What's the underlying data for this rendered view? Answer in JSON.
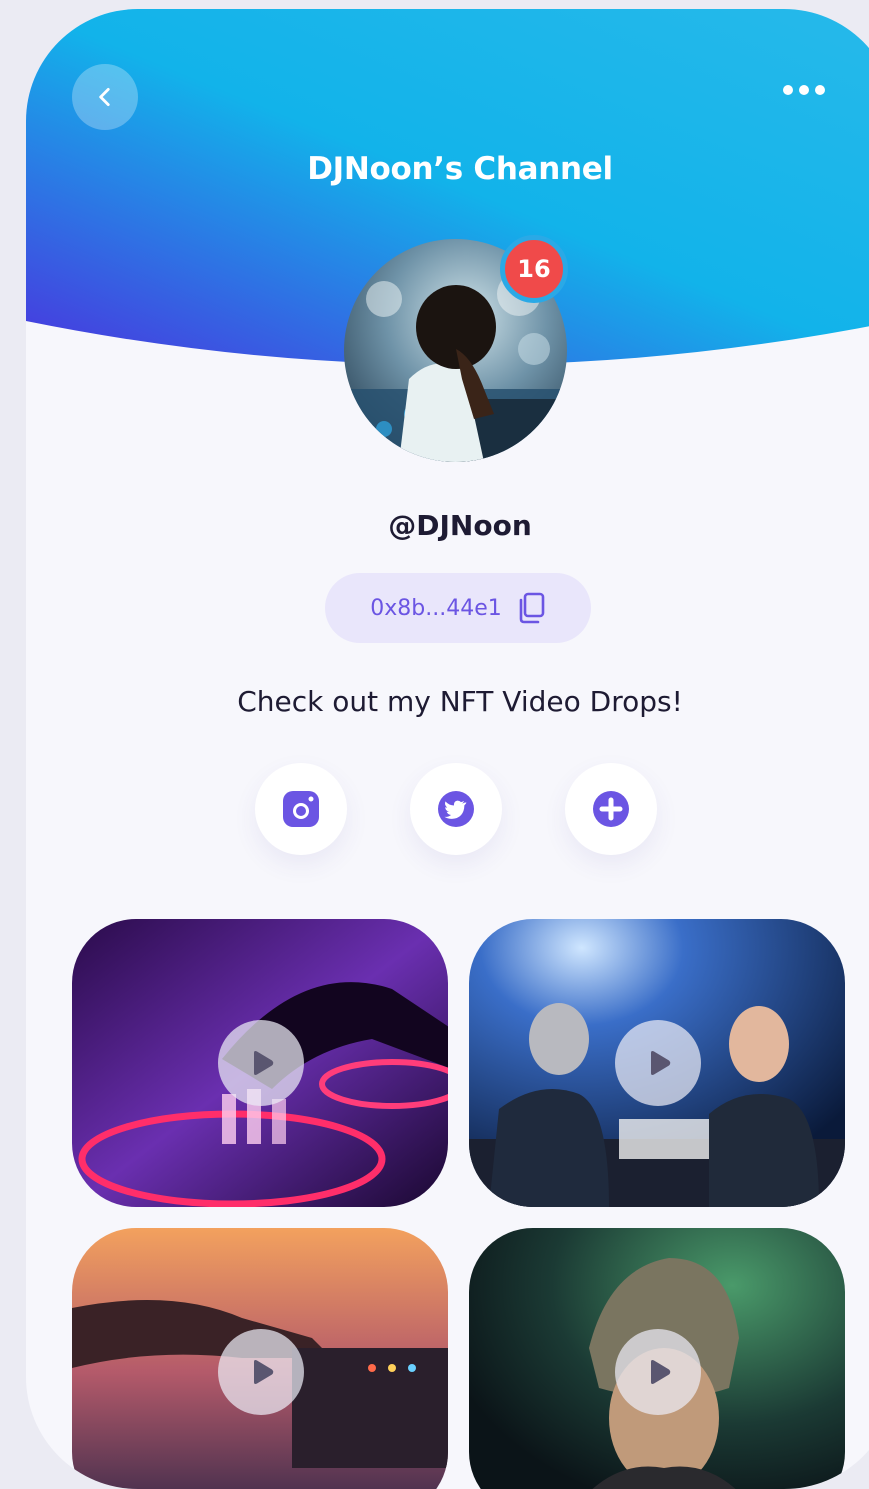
{
  "header": {
    "title": "DJNoon’s Channel",
    "back_icon": "chevron-left-icon",
    "more_icon": "more-horizontal-icon",
    "gradient": [
      "#4a33de",
      "#12b3ea",
      "#27b9ea"
    ]
  },
  "profile": {
    "notification_count": "16",
    "username": "@DJNoon",
    "wallet_address": "0x8b...44e1",
    "copy_icon": "copy-icon",
    "bio": "Check out my NFT Video Drops!"
  },
  "socials": [
    {
      "name": "instagram",
      "icon": "instagram-icon"
    },
    {
      "name": "twitter",
      "icon": "twitter-icon"
    },
    {
      "name": "add",
      "icon": "plus-circle-icon"
    }
  ],
  "videos": [
    {
      "theme": "purple-dj-turntable",
      "play_icon": "play-icon"
    },
    {
      "theme": "two-djs-stage",
      "play_icon": "play-icon"
    },
    {
      "theme": "sunset-dj-mixer",
      "play_icon": "play-icon"
    },
    {
      "theme": "green-smoke-dj",
      "play_icon": "play-icon"
    }
  ],
  "colors": {
    "accent": "#6b55e3",
    "badge": "#f04a4a",
    "background": "#f7f7fc",
    "text": "#1e1b33"
  }
}
